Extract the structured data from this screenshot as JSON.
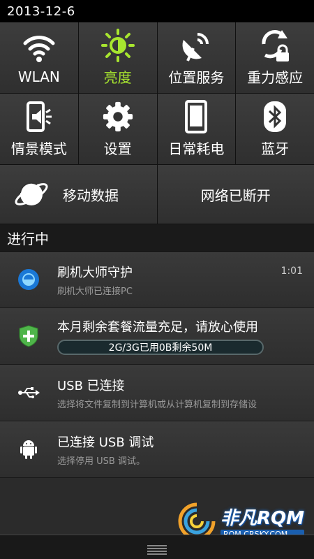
{
  "status_bar": {
    "date": "2013-12-6"
  },
  "quick_settings": {
    "row1": [
      {
        "label": "WLAN",
        "icon": "wifi-icon",
        "active": false
      },
      {
        "label": "亮度",
        "icon": "brightness-icon",
        "active": true
      },
      {
        "label": "位置服务",
        "icon": "location-icon",
        "active": false
      },
      {
        "label": "重力感应",
        "icon": "rotation-lock-icon",
        "active": false
      }
    ],
    "row2": [
      {
        "label": "情景模式",
        "icon": "sound-profile-icon"
      },
      {
        "label": "设置",
        "icon": "gear-icon"
      },
      {
        "label": "日常耗电",
        "icon": "phone-power-icon"
      },
      {
        "label": "蓝牙",
        "icon": "bluetooth-icon"
      }
    ],
    "row3": [
      {
        "label": "移动数据",
        "icon": "globe-icon"
      },
      {
        "label": "网络已断开"
      }
    ],
    "accent_color": "#a8e62f"
  },
  "ongoing": {
    "header": "进行中",
    "notifications": [
      {
        "title": "刷机大师守护",
        "subtitle": "刷机大师已连接PC",
        "time": "1:01",
        "icon": "flash-master-icon"
      },
      {
        "title": "本月剩余套餐流量充足，请放心使用",
        "progress_text": "2G/3G已用0B剩余50M",
        "icon": "shield-plus-icon"
      },
      {
        "title": "USB 已连接",
        "subtitle": "选择将文件复制到计算机或从计算机复制到存储设",
        "icon": "usb-icon"
      },
      {
        "title": "已连接 USB 调试",
        "subtitle": "选择停用 USB 调试。",
        "icon": "android-debug-icon"
      }
    ]
  },
  "watermark": {
    "brand": "非凡RQM",
    "url": "ROM.CRSKY.COM"
  }
}
